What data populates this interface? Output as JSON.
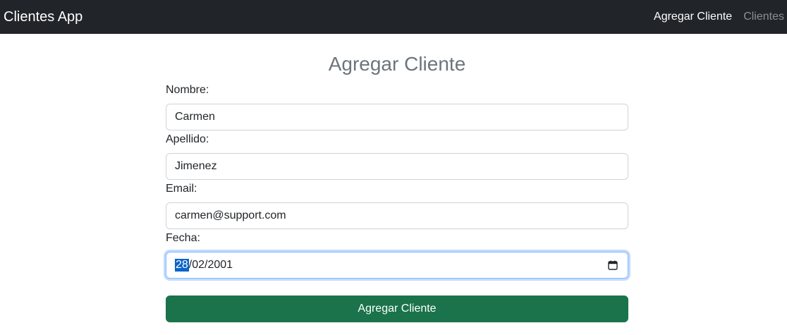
{
  "navbar": {
    "brand": "Clientes App",
    "links": [
      {
        "label": "Agregar Cliente",
        "active": true
      },
      {
        "label": "Clientes",
        "active": false
      }
    ]
  },
  "page": {
    "title": "Agregar Cliente"
  },
  "form": {
    "nombre": {
      "label": "Nombre:",
      "value": "Carmen"
    },
    "apellido": {
      "label": "Apellido:",
      "value": "Jimenez"
    },
    "email": {
      "label": "Email:",
      "value": "carmen@support.com"
    },
    "fecha": {
      "label": "Fecha:",
      "day": "28",
      "rest": "/02/2001",
      "icon": "calendar-icon"
    },
    "submit_label": "Agregar Cliente"
  },
  "colors": {
    "navbar_bg": "#212529",
    "button_bg": "#1a734a",
    "title": "#6c757d",
    "focus_border": "#86b7fe"
  }
}
